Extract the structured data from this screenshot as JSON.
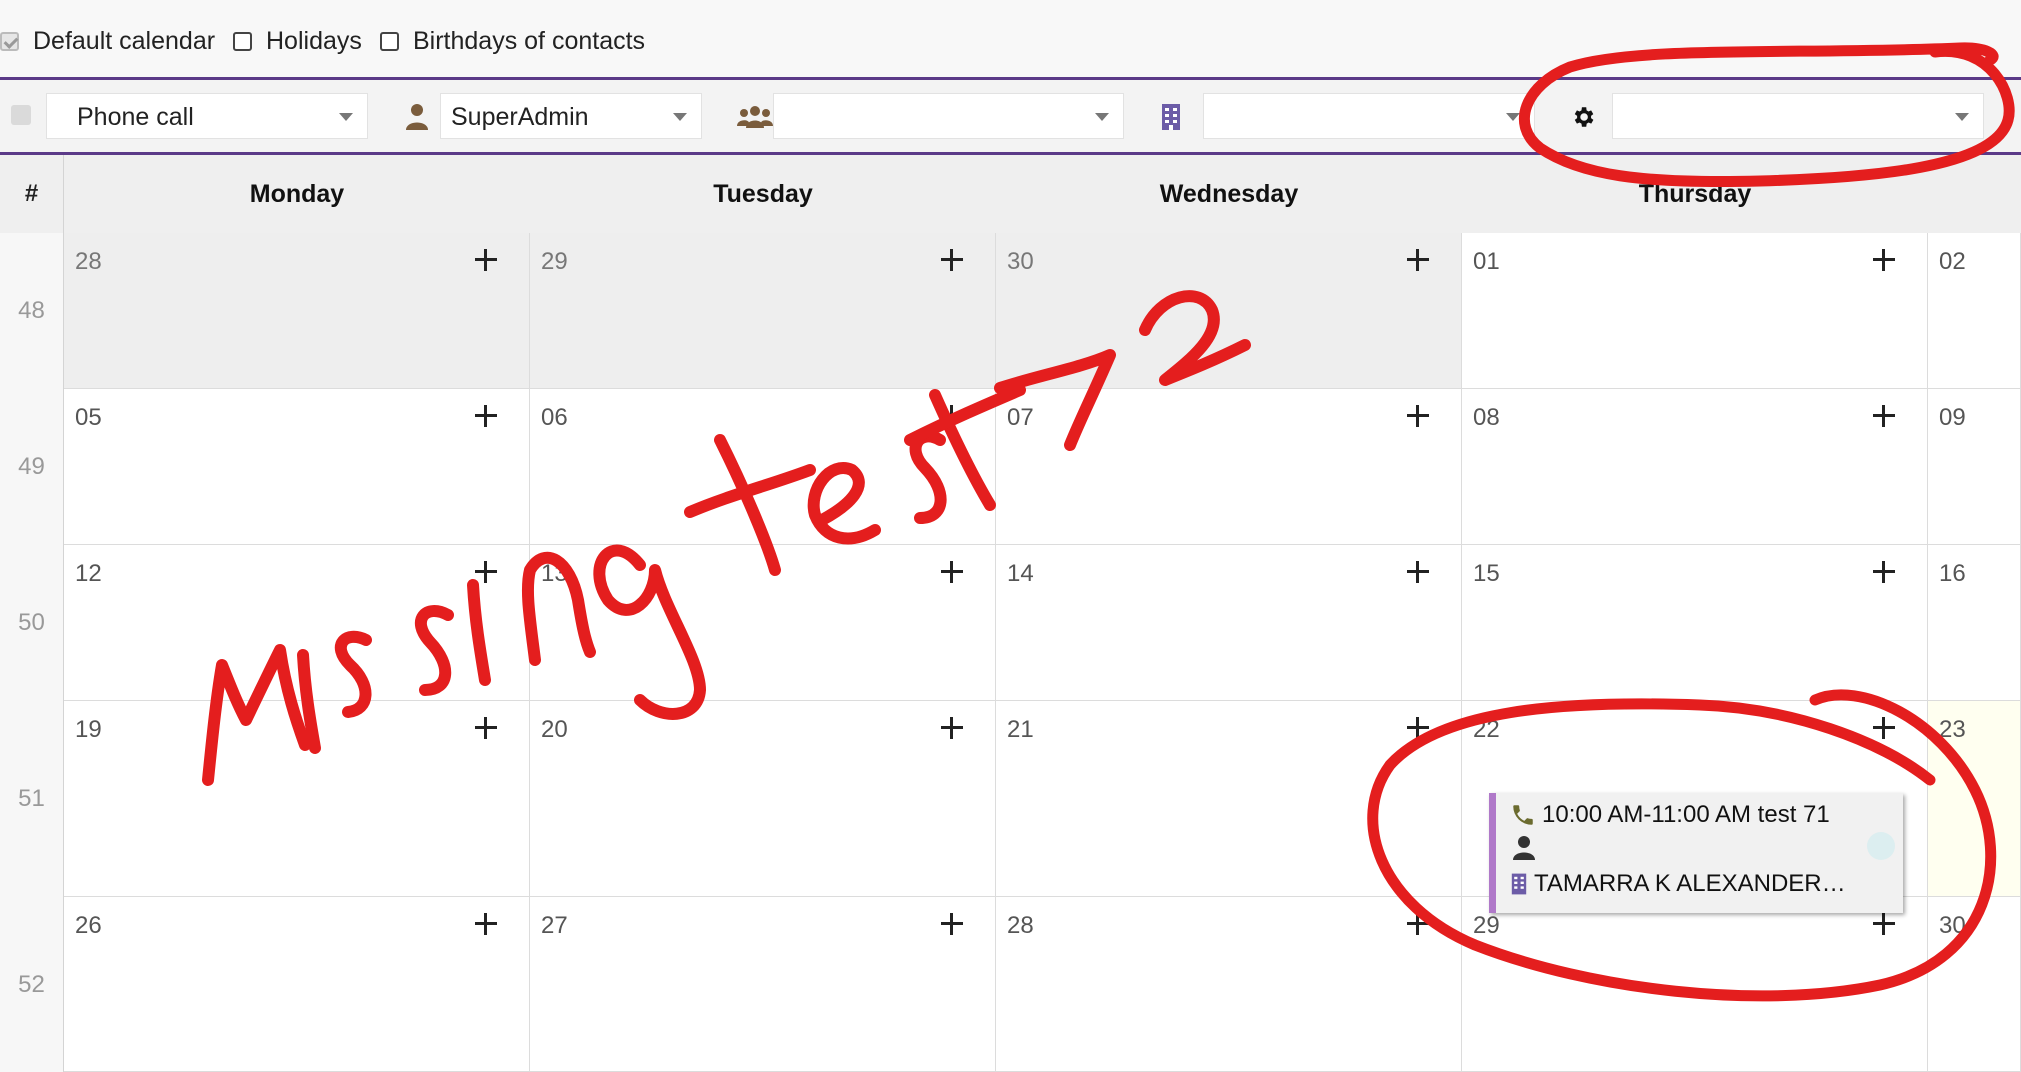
{
  "top_options": {
    "default_calendar": {
      "label": "Default calendar",
      "checked": true
    },
    "holidays": {
      "label": "Holidays",
      "checked": false
    },
    "birthdays": {
      "label": "Birthdays of contacts",
      "checked": false
    }
  },
  "filters": {
    "event_type": {
      "value": "Phone call",
      "icon": "tag"
    },
    "user": {
      "value": "SuperAdmin",
      "icon": "user-icon"
    },
    "group": {
      "value": "",
      "icon": "users-icon"
    },
    "company": {
      "value": "",
      "icon": "building-icon"
    },
    "resource": {
      "value": "",
      "icon": "gear-icon"
    }
  },
  "calendar": {
    "hash_label": "#",
    "days": [
      "Monday",
      "Tuesday",
      "Wednesday",
      "Thursday"
    ],
    "weeks": [
      {
        "week": "48",
        "dates": [
          "28",
          "29",
          "30",
          "01",
          "02"
        ]
      },
      {
        "week": "49",
        "dates": [
          "05",
          "06",
          "07",
          "08",
          "09"
        ]
      },
      {
        "week": "50",
        "dates": [
          "12",
          "13",
          "14",
          "15",
          "16"
        ]
      },
      {
        "week": "51",
        "dates": [
          "19",
          "20",
          "21",
          "22",
          "23"
        ]
      },
      {
        "week": "52",
        "dates": [
          "26",
          "27",
          "28",
          "29",
          "30"
        ]
      }
    ],
    "event": {
      "time_title": "10:00 AM-11:00 AM test 71",
      "organization": "TAMARRA K ALEXANDER…",
      "accent_color": "#b079c9"
    }
  },
  "annotations": {
    "handwritten_text": "Missing test 72",
    "color": "#e41e1e"
  }
}
